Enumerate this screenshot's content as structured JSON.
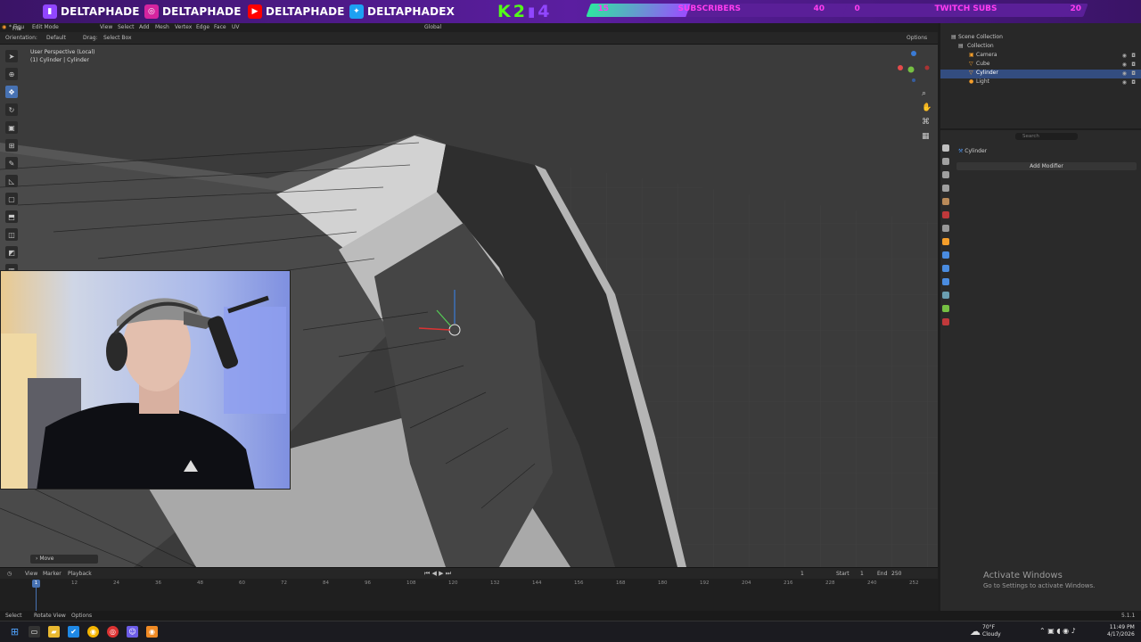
{
  "banner": {
    "socials": [
      {
        "handle": "DELTAPHADE",
        "icon": "twitch-icon",
        "color": "#9146ff"
      },
      {
        "handle": "DELTAPHADE",
        "icon": "instagram-icon",
        "color": "#d6249f"
      },
      {
        "handle": "DELTAPHADE",
        "icon": "youtube-icon",
        "color": "#ff0000"
      },
      {
        "handle": "DELTAPHADEX",
        "icon": "twitter-icon",
        "color": "#1da1f2"
      }
    ],
    "k_logo": {
      "k": "K",
      "num1": "2",
      "num2": "4"
    },
    "subscribers_goal": {
      "current": "15",
      "label": "SUBSCRIBERS",
      "goal": "40",
      "fraction": 0.375
    },
    "twitch_goal": {
      "current": "0",
      "label": "TWITCH SUBS",
      "goal": "20",
      "fraction": 0.0
    }
  },
  "header": {
    "window_title": "* Figu",
    "menu": [
      "File"
    ],
    "mode": "Edit Mode",
    "view_menu": [
      "View",
      "Select",
      "Add",
      "Mesh",
      "Vertex",
      "Edge",
      "Face",
      "UV"
    ],
    "orientation_label": "Orientation:",
    "orientation_value": "Default",
    "drag_label": "Drag:",
    "drag_value": "Select Box",
    "transform_orientation": "Global",
    "options_label": "Options"
  },
  "viewport": {
    "perspective": "User Perspective (Local)",
    "object_info": "(1) Cylinder | Cylinder",
    "last_op": "Move"
  },
  "timeline": {
    "menus": [
      "View",
      "Marker",
      "Playback"
    ],
    "current_frame": "1",
    "start_label": "Start",
    "start_value": "1",
    "end_label": "End",
    "end_value": "250",
    "playhead_frame": "1",
    "ticks": [
      "12",
      "24",
      "36",
      "48",
      "60",
      "72",
      "84",
      "96",
      "108",
      "120",
      "132",
      "144",
      "156",
      "168",
      "180",
      "192",
      "204",
      "216",
      "228",
      "240",
      "252"
    ]
  },
  "status": {
    "select": "Select",
    "rotate": "Rotate View",
    "options": "Options",
    "version": "5.1.1"
  },
  "outliner": {
    "root": "Scene Collection",
    "collection": "Collection",
    "items": [
      {
        "name": "Camera",
        "selected": false
      },
      {
        "name": "Cube",
        "selected": false
      },
      {
        "name": "Cylinder",
        "selected": true
      },
      {
        "name": "Light",
        "selected": false
      }
    ]
  },
  "properties": {
    "search_placeholder": "Search",
    "object_name": "Cylinder",
    "add_modifier": "Add Modifier"
  },
  "activate": {
    "title": "Activate Windows",
    "subtitle": "Go to Settings to activate Windows."
  },
  "taskbar": {
    "weather_temp": "70°F",
    "weather_desc": "Cloudy",
    "time": "11:49 PM",
    "date": "4/17/2026"
  }
}
